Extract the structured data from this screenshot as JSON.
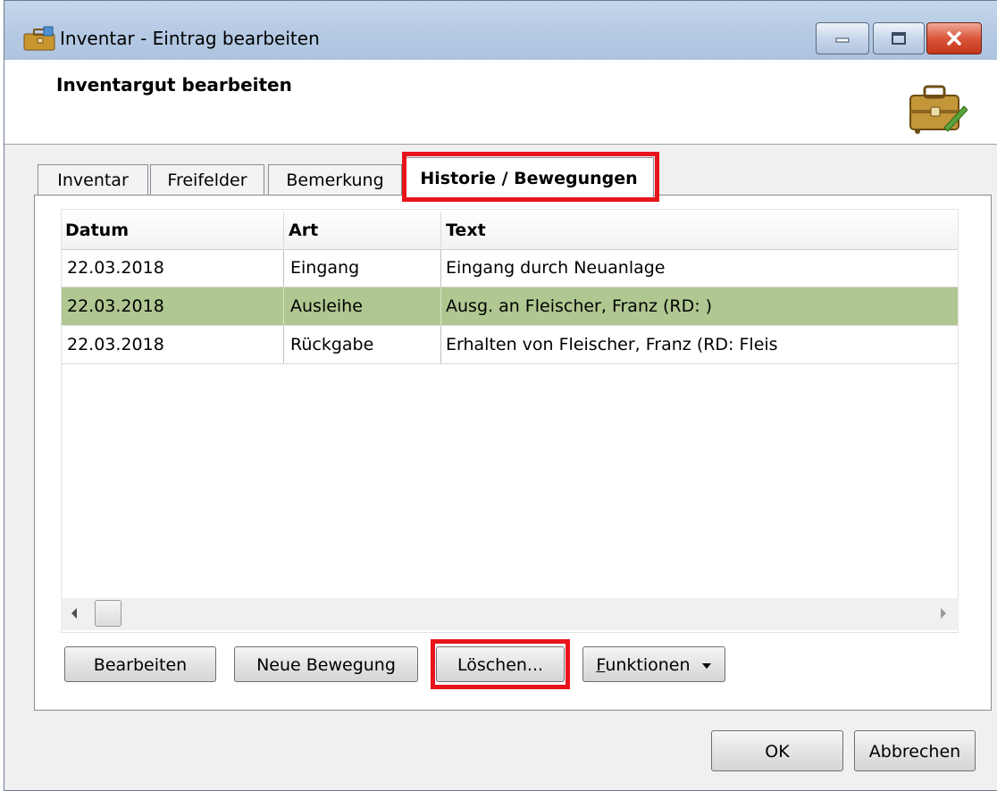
{
  "window": {
    "title": "Inventar - Eintrag bearbeiten",
    "header_title": "Inventargut bearbeiten"
  },
  "tabs": [
    {
      "label": "Inventar",
      "active": false
    },
    {
      "label": "Freifelder",
      "active": false
    },
    {
      "label": "Bemerkung",
      "active": false
    },
    {
      "label": "Historie / Bewegungen",
      "active": true
    }
  ],
  "grid": {
    "columns": [
      "Datum",
      "Art",
      "Text"
    ],
    "rows": [
      {
        "datum": "22.03.2018",
        "art": "Eingang",
        "text": "Eingang durch Neuanlage",
        "selected": false
      },
      {
        "datum": "22.03.2018",
        "art": "Ausleihe",
        "text": "Ausg. an Fleischer, Franz (RD: )",
        "selected": true
      },
      {
        "datum": "22.03.2018",
        "art": "Rückgabe",
        "text": "Erhalten von Fleischer, Franz (RD: Fleis",
        "selected": false
      }
    ]
  },
  "buttons": {
    "edit": "Bearbeiten",
    "new_movement": "Neue Bewegung",
    "delete": "Löschen...",
    "functions_first": "F",
    "functions_rest": "unktionen",
    "ok": "OK",
    "cancel": "Abbrechen"
  },
  "colors": {
    "selected_row": "#b0c791",
    "highlight_box": "#e8141c",
    "titlebar": "#b6cbe4"
  }
}
